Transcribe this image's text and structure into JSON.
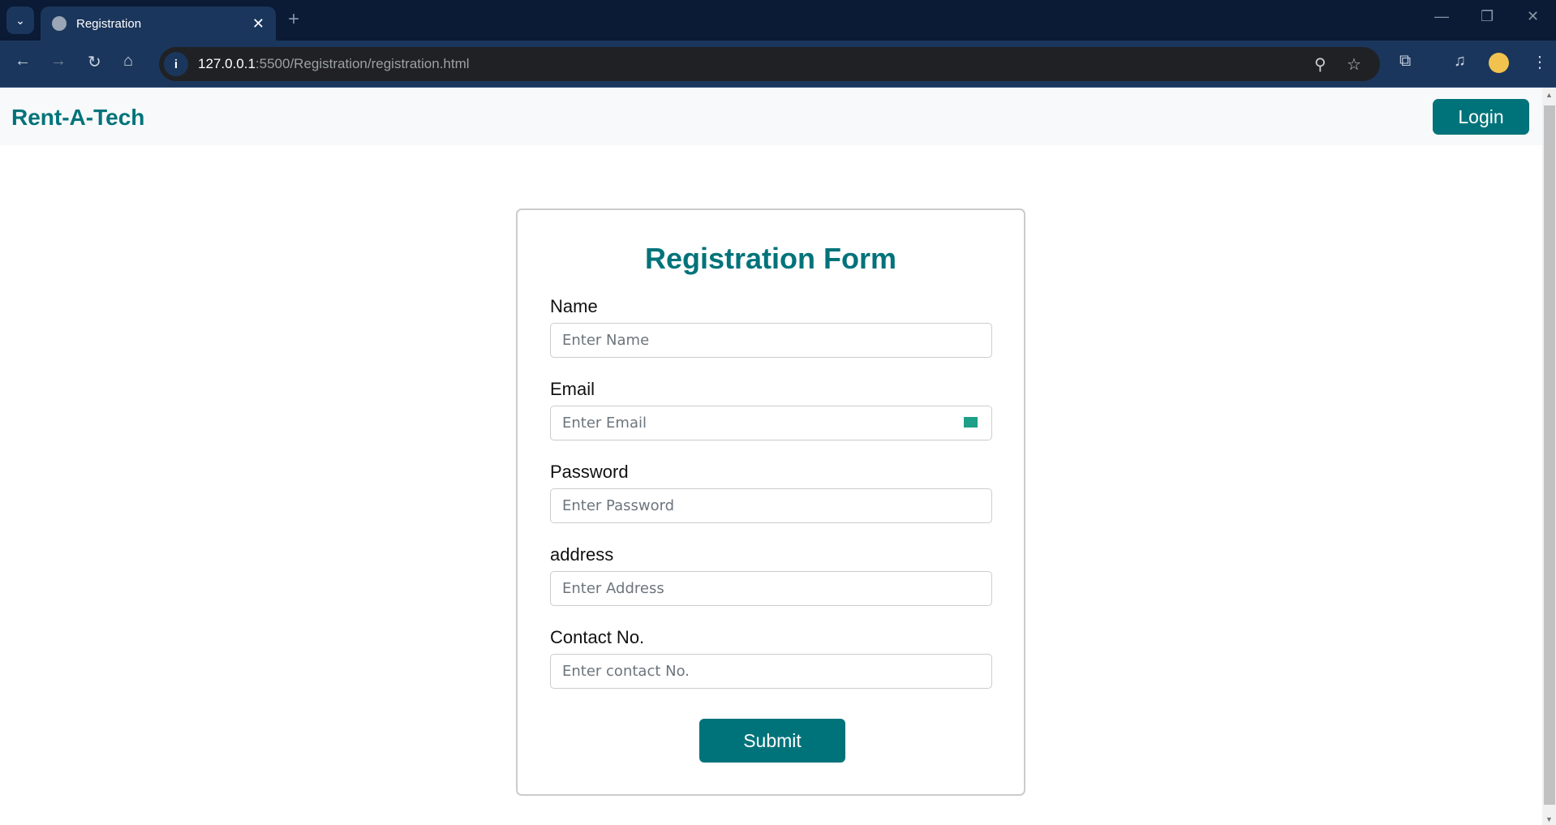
{
  "browser": {
    "tab_title": "Registration",
    "url_host": "127.0.0.1",
    "url_rest": ":5500/Registration/registration.html"
  },
  "header": {
    "brand": "Rent-A-Tech",
    "login_label": "Login"
  },
  "form": {
    "title": "Registration Form",
    "fields": [
      {
        "label": "Name",
        "placeholder": "Enter Name",
        "value": ""
      },
      {
        "label": "Email",
        "placeholder": "Enter Email",
        "value": ""
      },
      {
        "label": "Password",
        "placeholder": "Enter Password",
        "value": ""
      },
      {
        "label": "address",
        "placeholder": "Enter Address",
        "value": ""
      },
      {
        "label": "Contact No.",
        "placeholder": "Enter contact No.",
        "value": ""
      }
    ],
    "submit_label": "Submit"
  },
  "colors": {
    "accent": "#00737a"
  }
}
